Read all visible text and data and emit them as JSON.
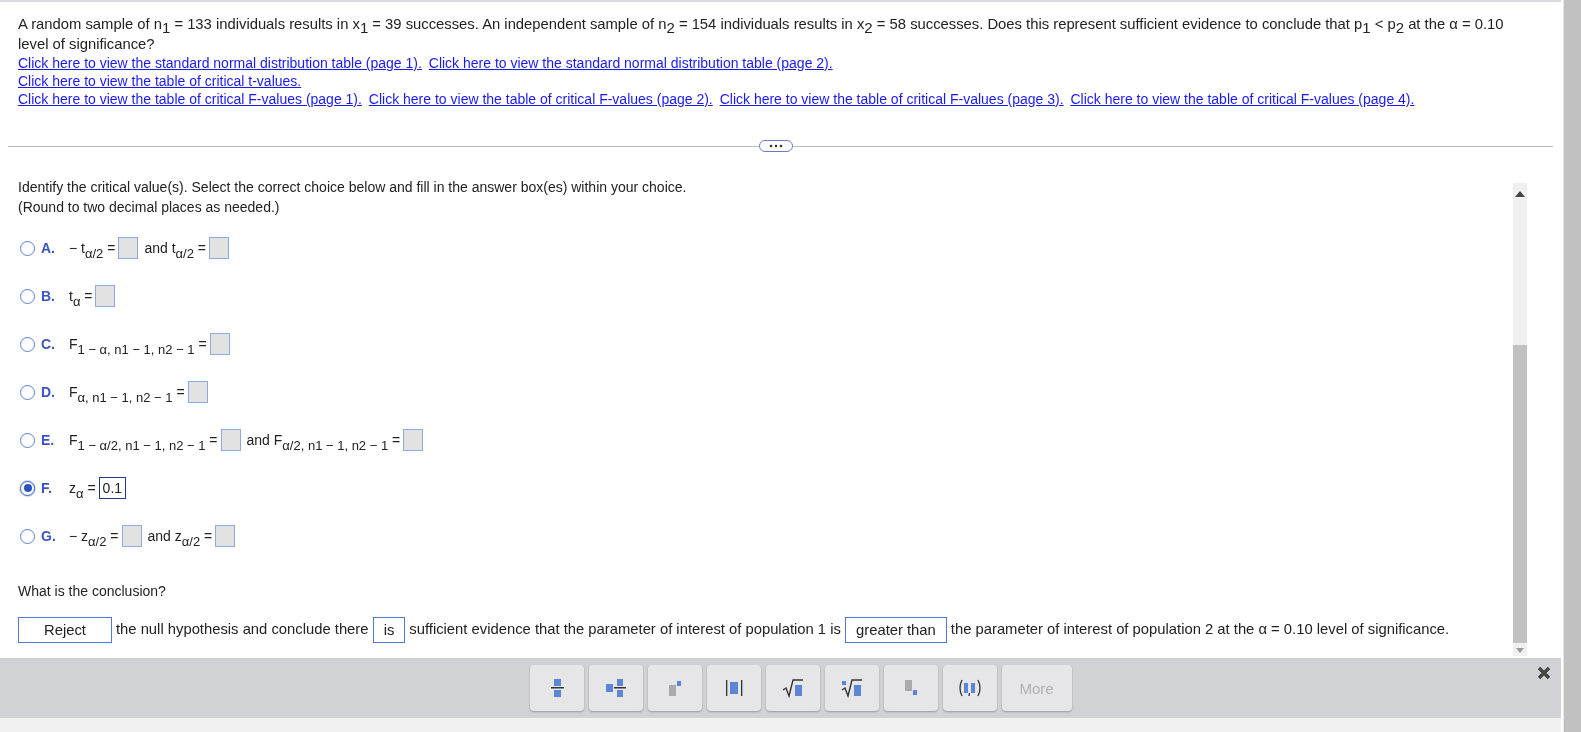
{
  "question": {
    "text": "A random sample of n$_{1}$ = 133 individuals results in x$_{1}$ = 39 successes. An independent sample of n$_{2}$ = 154 individuals results in x$_{2}$ = 58 successes. Does this represent sufficient evidence to conclude that p$_{1}$ < p$_{2}$ at the α = 0.10 level of significance?",
    "link_lines": [
      [
        "Click here to view the standard normal distribution table (page 1).",
        "Click here to view the standard normal distribution table (page 2)."
      ],
      [
        "Click here to view the table of critical t-values."
      ],
      [
        "Click here to view the table of critical F-values (page 1).",
        "Click here to view the table of critical F-values (page 2).",
        "Click here to view the table of critical F-values (page 3).",
        "Click here to view the table of critical F-values (page 4)."
      ]
    ]
  },
  "instruction": "Identify the critical value(s). Select the correct choice below and fill in the answer box(es) within your choice.",
  "hint": "(Round to two decimal places as needed.)",
  "options": [
    {
      "letter": "A.",
      "selected": false,
      "parts": [
        {
          "kind": "text",
          "text": "− t$_{α/2}$ ="
        },
        {
          "kind": "box"
        },
        {
          "kind": "text",
          "text": "and t$_{α/2}$ ="
        },
        {
          "kind": "box"
        }
      ]
    },
    {
      "letter": "B.",
      "selected": false,
      "parts": [
        {
          "kind": "text",
          "text": "t$_{α}$ ="
        },
        {
          "kind": "box"
        }
      ]
    },
    {
      "letter": "C.",
      "selected": false,
      "parts": [
        {
          "kind": "text",
          "text": "F$_{1 − α, n1 − 1, n2 − 1}$ ="
        },
        {
          "kind": "box"
        }
      ]
    },
    {
      "letter": "D.",
      "selected": false,
      "parts": [
        {
          "kind": "text",
          "text": "F$_{α, n1 − 1, n2 − 1}$ ="
        },
        {
          "kind": "box"
        }
      ]
    },
    {
      "letter": "E.",
      "selected": false,
      "parts": [
        {
          "kind": "text",
          "text": "F$_{1 − α/2, n1 − 1, n2 − 1}$ ="
        },
        {
          "kind": "box"
        },
        {
          "kind": "text",
          "text": "and F$_{α/2, n1 − 1, n2 − 1}$ ="
        },
        {
          "kind": "box"
        }
      ]
    },
    {
      "letter": "F.",
      "selected": true,
      "parts": [
        {
          "kind": "text",
          "text": "z$_{α}$ ="
        },
        {
          "kind": "box",
          "value": "0.1"
        }
      ]
    },
    {
      "letter": "G.",
      "selected": false,
      "parts": [
        {
          "kind": "text",
          "text": "− z$_{α/2}$ ="
        },
        {
          "kind": "box"
        },
        {
          "kind": "text",
          "text": "and z$_{α/2}$ ="
        },
        {
          "kind": "box"
        }
      ]
    }
  ],
  "conclusion_prompt": "What is the conclusion?",
  "conclusion": [
    {
      "kind": "answer",
      "text": "Reject"
    },
    {
      "kind": "text",
      "text": "the null hypothesis and conclude there"
    },
    {
      "kind": "answer",
      "text": "is"
    },
    {
      "kind": "text",
      "text": "sufficient evidence that the parameter of interest of population 1 is"
    },
    {
      "kind": "answer",
      "text": "greater than"
    },
    {
      "kind": "text",
      "text": "the parameter of interest of population 2 at the α = 0.10 level of significance."
    }
  ],
  "toolbar": [
    {
      "kind": "fraction"
    },
    {
      "kind": "mixed"
    },
    {
      "kind": "power"
    },
    {
      "kind": "abs"
    },
    {
      "kind": "sqrt"
    },
    {
      "kind": "root"
    },
    {
      "kind": "subscript"
    },
    {
      "kind": "pair"
    },
    {
      "kind": "more",
      "label": "More",
      "disabled": true
    }
  ]
}
